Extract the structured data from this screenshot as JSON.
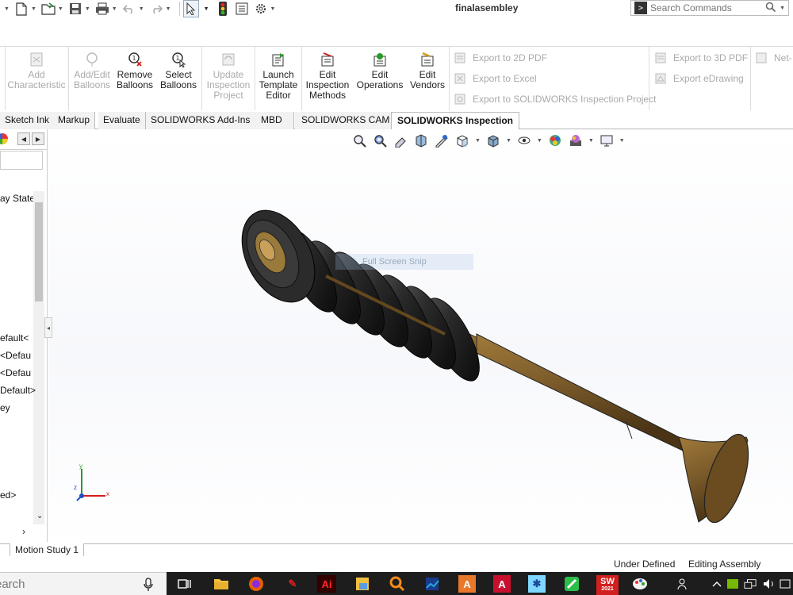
{
  "window": {
    "title": "finalasembley"
  },
  "search": {
    "placeholder": "Search Commands"
  },
  "quick_access": {
    "icons": [
      "solidworks-logo-caret-icon",
      "new-document-icon",
      "open-folder-icon",
      "save-icon",
      "print-icon",
      "undo-icon",
      "redo-icon",
      "select-arrow-icon",
      "rebuild-traffic-light-icon",
      "file-properties-icon",
      "options-gear-icon"
    ]
  },
  "ribbon": {
    "add_characteristic": "Add Characteristic",
    "add_edit_balloons": "Add/Edit Balloons",
    "remove_balloons": "Remove Balloons",
    "select_balloons": "Select Balloons",
    "update_inspection_project": "Update Inspection Project",
    "launch_template_editor": "Launch Template Editor",
    "edit_inspection_methods": "Edit Inspection Methods",
    "edit_operations": "Edit Operations",
    "edit_vendors": "Edit Vendors",
    "export_2d_pdf": "Export to 2D PDF",
    "export_excel": "Export to Excel",
    "export_sw_inspection_project": "Export to SOLIDWORKS Inspection Project",
    "export_3d_pdf": "Export to 3D PDF",
    "export_edrawing": "Export eDrawing",
    "net": "Net-"
  },
  "tabs": [
    {
      "label": "Sketch Ink"
    },
    {
      "label": "Markup"
    },
    {
      "label": "Evaluate"
    },
    {
      "label": "SOLIDWORKS Add-Ins"
    },
    {
      "label": "MBD"
    },
    {
      "label": "SOLIDWORKS CAM"
    },
    {
      "label": "SOLIDWORKS Inspection",
      "active": true
    }
  ],
  "tree": {
    "display_state": "ay State",
    "items": [
      "efault<",
      "<Defau",
      "<Defau",
      "Default>",
      "ey",
      "ed>"
    ]
  },
  "overlay": {
    "snip_text": "Full Screen Snip"
  },
  "triad": {
    "x": "x",
    "y": "y",
    "z": "z"
  },
  "motion_study": {
    "tab": "Motion Study 1"
  },
  "status": {
    "state": "Under Defined",
    "mode": "Editing Assembly"
  },
  "taskbar": {
    "search_placeholder": "earch",
    "apps": [
      "task-view-icon",
      "file-explorer-icon",
      "firefox-icon",
      "acrobat-icon",
      "illustrator-icon",
      "file-manager-icon",
      "search-tool-icon",
      "chart-app-icon",
      "app-a-orange-icon",
      "autocad-icon",
      "asterisk-app-icon",
      "line-app-icon",
      "solidworks-2021-icon",
      "paint-icon"
    ],
    "solidworks_year": "2021",
    "ai_label": "Ai",
    "colors": {
      "taskbar_bg": "#1d1d1d",
      "accent_red": "#d21f1f"
    }
  },
  "model": {
    "spring_color": "#2a2a2a",
    "valve_stem_color": "#7a5a2a"
  }
}
